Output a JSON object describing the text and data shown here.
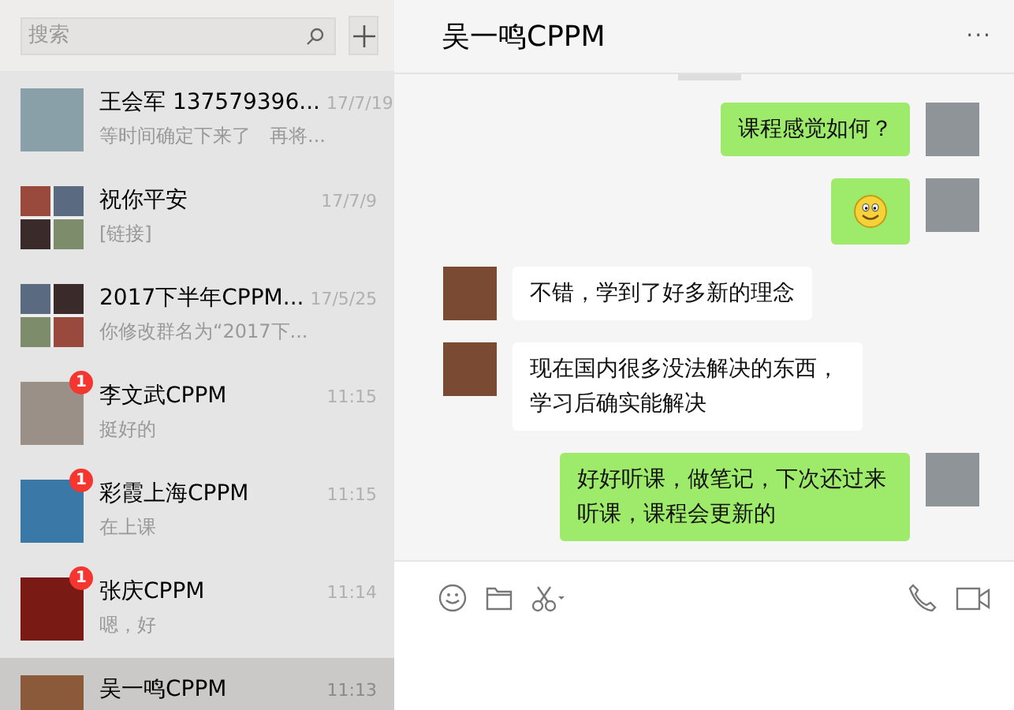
{
  "search": {
    "placeholder": "搜索"
  },
  "chats": [
    {
      "name": "王会军 137579396...",
      "time": "17/7/19",
      "preview": "等时间确定下来了　再将...",
      "group": false,
      "selected": false
    },
    {
      "name": "祝你平安",
      "time": "17/7/9",
      "preview": "[链接]",
      "group": true,
      "selected": false
    },
    {
      "name": "2017下半年CPPM...",
      "time": "17/5/25",
      "preview": "你修改群名为“2017下...",
      "group": true,
      "selected": false
    },
    {
      "name": "李文武CPPM",
      "time": "11:15",
      "preview": "挺好的",
      "group": false,
      "unread": "1",
      "selected": false
    },
    {
      "name": "彩霞上海CPPM",
      "time": "11:15",
      "preview": "在上课",
      "group": false,
      "unread": "1",
      "selected": false
    },
    {
      "name": "张庆CPPM",
      "time": "11:14",
      "preview": "嗯，好",
      "group": false,
      "unread": "1",
      "selected": false
    },
    {
      "name": "吴一鸣CPPM",
      "time": "11:13",
      "group": false,
      "selected": true
    }
  ],
  "chat": {
    "title": "吴一鸣CPPM",
    "more": "···",
    "messages": [
      {
        "outgoing": true,
        "kind": "text",
        "text": "课程感觉如何？"
      },
      {
        "outgoing": true,
        "kind": "emoji"
      },
      {
        "outgoing": false,
        "kind": "text",
        "text": "不错，学到了好多新的理念"
      },
      {
        "outgoing": false,
        "kind": "text",
        "text": "现在国内很多没法解决的东西，学习后确实能解决"
      },
      {
        "outgoing": true,
        "kind": "text",
        "text": "好好听课，做笔记，下次还过来听课，课程会更新的"
      }
    ]
  }
}
